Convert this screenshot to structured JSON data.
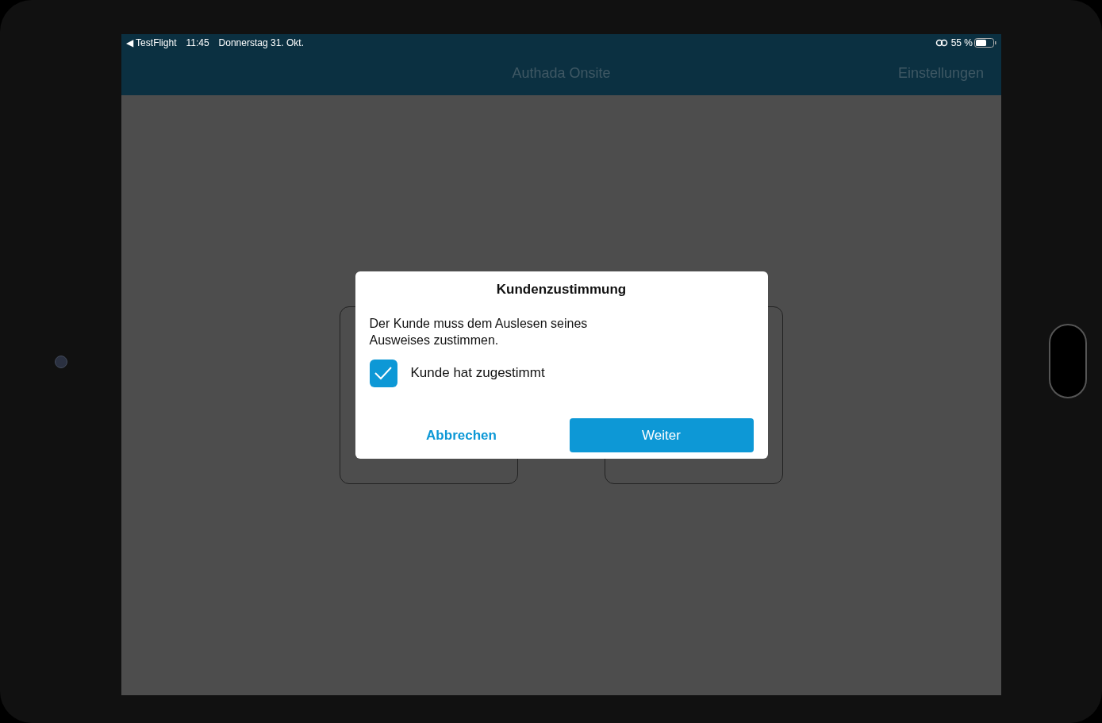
{
  "status_bar": {
    "back_label": "◀ TestFlight",
    "time": "11:45",
    "date": "Donnerstag 31. Okt.",
    "battery": "55 %"
  },
  "nav_bar": {
    "title": "Authada Onsite",
    "action": "Einstellungen"
  },
  "dialog": {
    "title": "Kundenzustimmung",
    "message": "Der Kunde muss dem Auslesen seines Ausweises zustimmen.",
    "checkbox": {
      "label": "Kunde hat zugestimmt",
      "checked": true
    },
    "buttons": [
      {
        "label": "Abbrechen",
        "kind": "text"
      },
      {
        "label": "Weiter",
        "kind": "primary"
      }
    ]
  }
}
